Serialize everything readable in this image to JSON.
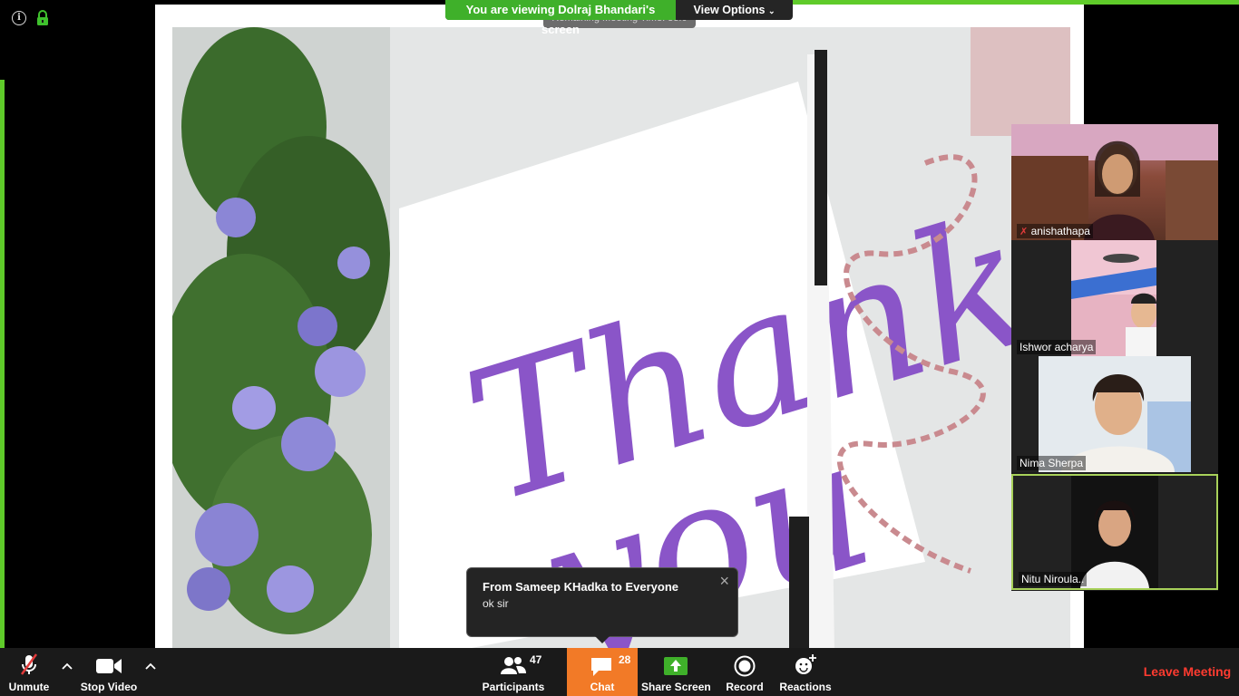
{
  "banner": {
    "viewing_text": "You are viewing Dolraj Bhandari's screen",
    "view_options": "View Options"
  },
  "meeting_timer": "Remaining Meeting Time: 38:0",
  "participants": [
    {
      "name": "anishathapa",
      "muted": true
    },
    {
      "name": "Ishwor acharya",
      "muted": false
    },
    {
      "name": "Nima Sherpa",
      "muted": false
    },
    {
      "name": "Nitu Niroula..",
      "muted": false,
      "active_speaker": true
    }
  ],
  "chat_toast": {
    "title": "From Sameep KHadka to Everyone",
    "message": "ok sir"
  },
  "toolbar": {
    "unmute": "Unmute",
    "stop_video": "Stop Video",
    "participants": "Participants",
    "participants_count": "47",
    "chat": "Chat",
    "chat_count": "28",
    "share_screen": "Share Screen",
    "record": "Record",
    "reactions": "Reactions",
    "leave": "Leave Meeting"
  },
  "colors": {
    "share_green": "#5fcb2a",
    "chat_active": "#f27a27",
    "leave_red": "#ff3b30",
    "toolbar_bg": "#1a1a1a"
  }
}
